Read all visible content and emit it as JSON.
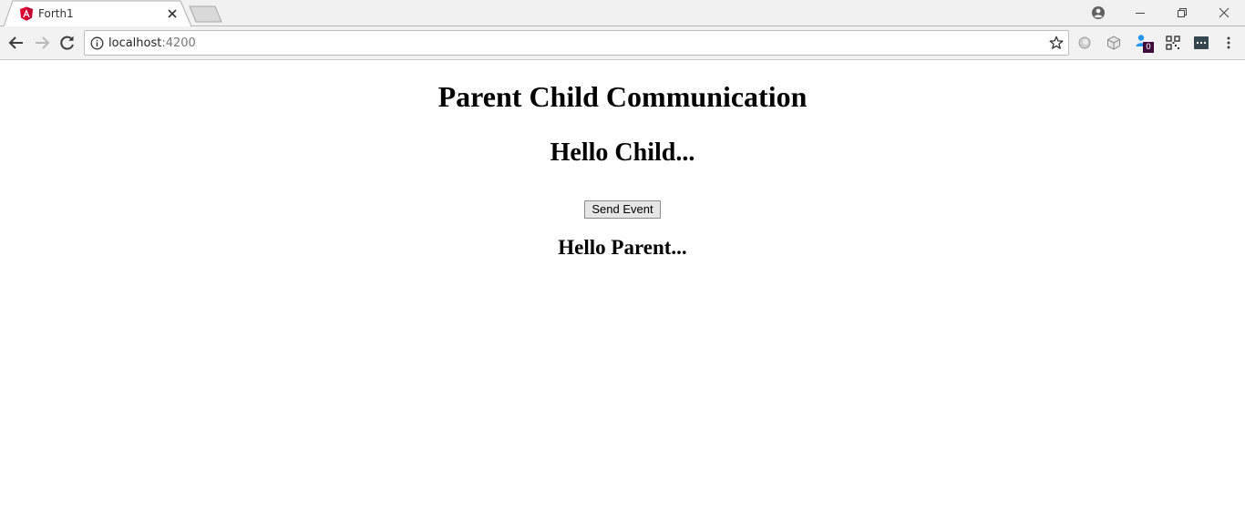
{
  "browser": {
    "tab": {
      "title": "Forth1",
      "favicon": "angular-logo-icon"
    },
    "address_bar": {
      "host": "localhost",
      "port": ":4200"
    },
    "extensions": {
      "badge_count": "0"
    }
  },
  "page": {
    "title": "Parent Child Communication",
    "child_message": "Hello Child...",
    "send_button_label": "Send Event",
    "parent_message": "Hello Parent..."
  },
  "colors": {
    "angular_red": "#dd0031",
    "extension_blue": "#2196f3"
  }
}
